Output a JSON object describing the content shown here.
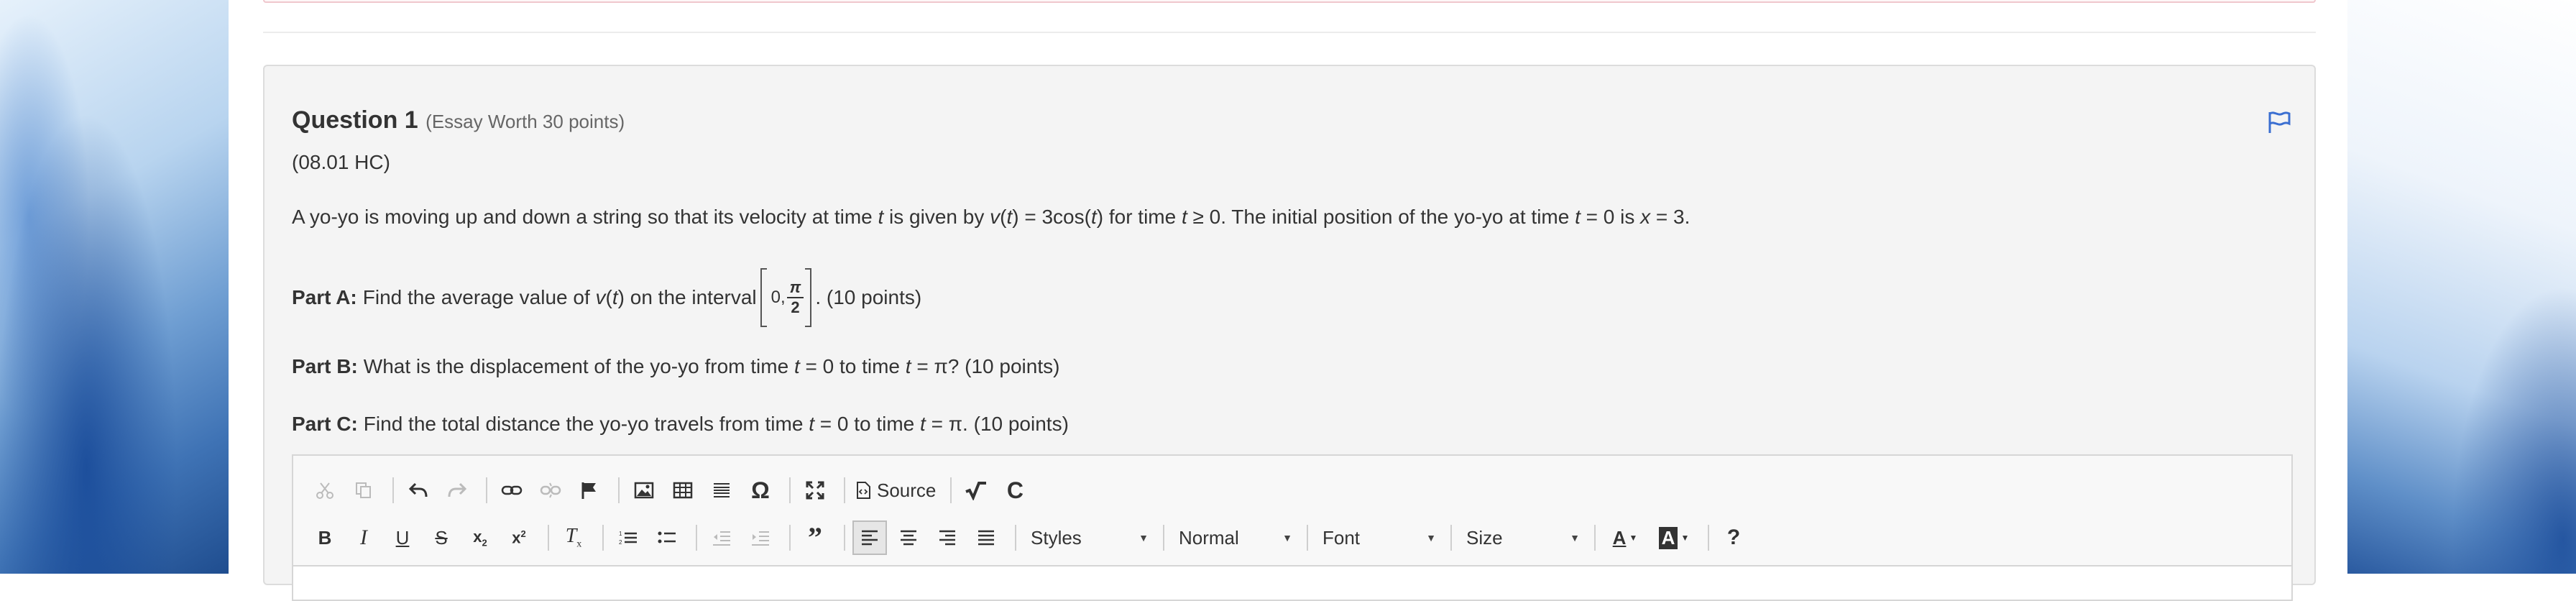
{
  "question": {
    "title": "Question 1",
    "type_label": "(Essay Worth 30 points)",
    "code": "(08.01 HC)",
    "stem": "A yo-yo is moving up and down a string so that its velocity at time t is given by v(t) = 3cos(t) for time t ≥ 0. The initial position of the yo-yo at time t = 0 is x = 3.",
    "parts": [
      {
        "label": "Part A:",
        "text_before": "Find the average value of v(t) on the interval",
        "interval_left": "0,",
        "interval_num": "π",
        "interval_den": "2",
        "text_after": ". (10 points)"
      },
      {
        "label": "Part B:",
        "text": "What is the displacement of the yo-yo from time t = 0 to time t = π? (10 points)"
      },
      {
        "label": "Part C:",
        "text": "Find the total distance the yo-yo travels from time t = 0 to time t = π. (10 points)"
      }
    ]
  },
  "editor": {
    "source_label": "Source",
    "styles_label": "Styles",
    "format_label": "Normal",
    "font_label": "Font",
    "size_label": "Size",
    "help_label": "?"
  },
  "colors": {
    "flag": "#3b6fd1",
    "card_bg": "#f4f4f4"
  }
}
